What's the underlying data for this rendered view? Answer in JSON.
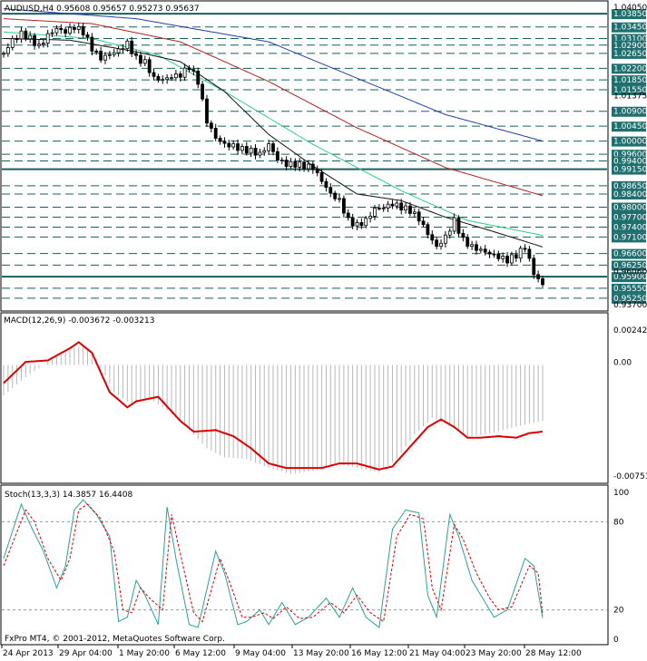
{
  "colors": {
    "background": "#ffffff",
    "grid": "#000000",
    "candle": "#000000",
    "level_line": "#1a5f5f",
    "ma_blue": "#1f3fa8",
    "ma_red": "#b22222",
    "ma_green": "#2ecc8a",
    "ma_black": "#111111",
    "macd_signal": "#dd0000",
    "macd_hist": "#b8b8b8",
    "stoch_main": "#2aa198",
    "stoch_signal": "#dd0000",
    "label_box": "#1f6f6f"
  },
  "header": {
    "symbol_info": "AUDUSD,H4  0.95608 0.95657 0.95273 0.95637"
  },
  "macd_panel": {
    "title": "MACD(12,26,9) -0.003672 -0.003213",
    "ticks": [
      "0.002422",
      "0.00",
      "-0.00751"
    ]
  },
  "stoch_panel": {
    "title": "Stoch(13,3,3) 14.3857 16.4408",
    "ticks": [
      "100",
      "80",
      "20",
      "0"
    ]
  },
  "copyright": "FxPro MT4, © 2001-2012, MetaQuotes Software Corp.",
  "price_axis": {
    "plain_ticks": [
      "1.04050",
      "1.01375",
      "0.96060",
      "0.93700"
    ],
    "level_labels": [
      "1.03850",
      "1.03450",
      "1.03100",
      "1.02900",
      "1.02650",
      "1.02200",
      "1.01850",
      "1.01550",
      "1.00900",
      "1.00450",
      "1.00000",
      "0.99600",
      "0.99400",
      "0.99150",
      "0.98650",
      "0.98400",
      "0.98000",
      "0.97700",
      "0.97400",
      "0.97100",
      "0.96600",
      "0.96250",
      "0.95900",
      "0.95550",
      "0.95250"
    ],
    "dark_levels": [
      "1.03850",
      "0.99150",
      "0.95900"
    ]
  },
  "time_axis": {
    "labels": [
      "24 Apr 2013",
      "29 Apr 04:00",
      "1 May 20:00",
      "6 May 12:00",
      "9 May 04:00",
      "13 May 20:00",
      "16 May 12:00",
      "21 May 04:00",
      "23 May 20:00",
      "28 May 12:00"
    ]
  },
  "chart_data": {
    "type": "line",
    "title": "AUDUSD,H4",
    "price_range": [
      0.95,
      1.041
    ],
    "close_anchors": [
      [
        0,
        1.0265
      ],
      [
        4,
        1.0305
      ],
      [
        8,
        1.0325
      ],
      [
        12,
        1.031
      ],
      [
        16,
        1.0285
      ],
      [
        20,
        1.032
      ],
      [
        24,
        1.034
      ],
      [
        28,
        1.033
      ],
      [
        32,
        1.0345
      ],
      [
        36,
        1.033
      ],
      [
        40,
        1.028
      ],
      [
        44,
        1.025
      ],
      [
        48,
        1.0262
      ],
      [
        52,
        1.0275
      ],
      [
        56,
        1.0295
      ],
      [
        60,
        1.025
      ],
      [
        64,
        1.0238
      ],
      [
        68,
        1.019
      ],
      [
        72,
        1.0185
      ],
      [
        76,
        1.0195
      ],
      [
        80,
        1.02
      ],
      [
        84,
        1.0225
      ],
      [
        88,
        1.018
      ],
      [
        92,
        1.006
      ],
      [
        96,
        1.001
      ],
      [
        100,
        0.999
      ],
      [
        104,
        0.9985
      ],
      [
        108,
        0.9975
      ],
      [
        112,
        0.997
      ],
      [
        116,
        0.996
      ],
      [
        120,
        0.999
      ],
      [
        124,
        0.9945
      ],
      [
        128,
        0.993
      ],
      [
        132,
        0.993
      ],
      [
        136,
        0.9925
      ],
      [
        140,
        0.992
      ],
      [
        144,
        0.988
      ],
      [
        148,
        0.984
      ],
      [
        152,
        0.982
      ],
      [
        156,
        0.976
      ],
      [
        160,
        0.9745
      ],
      [
        164,
        0.976
      ],
      [
        168,
        0.9795
      ],
      [
        172,
        0.98
      ],
      [
        176,
        0.981
      ],
      [
        180,
        0.98
      ],
      [
        184,
        0.979
      ],
      [
        188,
        0.9765
      ],
      [
        192,
        0.972
      ],
      [
        196,
        0.968
      ],
      [
        200,
        0.971
      ],
      [
        204,
        0.976
      ],
      [
        208,
        0.97
      ],
      [
        212,
        0.968
      ],
      [
        216,
        0.967
      ],
      [
        220,
        0.966
      ],
      [
        224,
        0.965
      ],
      [
        228,
        0.964
      ],
      [
        232,
        0.9655
      ],
      [
        236,
        0.968
      ],
      [
        240,
        0.96
      ],
      [
        244,
        0.9565
      ]
    ],
    "ma_blue": [
      [
        0,
        1.04
      ],
      [
        60,
        1.037
      ],
      [
        120,
        1.03
      ],
      [
        160,
        1.019
      ],
      [
        200,
        1.008
      ],
      [
        244,
        1.0
      ]
    ],
    "ma_red": [
      [
        0,
        1.037
      ],
      [
        40,
        1.0355
      ],
      [
        80,
        1.03
      ],
      [
        120,
        1.018
      ],
      [
        160,
        1.004
      ],
      [
        200,
        0.992
      ],
      [
        244,
        0.9835
      ]
    ],
    "ma_green": [
      [
        0,
        1.033
      ],
      [
        40,
        1.031
      ],
      [
        70,
        1.026
      ],
      [
        100,
        1.015
      ],
      [
        140,
        0.999
      ],
      [
        180,
        0.985
      ],
      [
        210,
        0.976
      ],
      [
        244,
        0.9715
      ]
    ],
    "ma_black": [
      [
        0,
        1.031
      ],
      [
        30,
        1.0305
      ],
      [
        60,
        1.027
      ],
      [
        80,
        1.024
      ],
      [
        100,
        1.015
      ],
      [
        120,
        1.002
      ],
      [
        140,
        0.9925
      ],
      [
        160,
        0.984
      ],
      [
        180,
        0.982
      ],
      [
        200,
        0.977
      ],
      [
        220,
        0.973
      ],
      [
        244,
        0.968
      ]
    ],
    "macd_range": [
      -0.00751,
      0.002422
    ],
    "macd_signal": [
      [
        0,
        -0.0012
      ],
      [
        10,
        0.0002
      ],
      [
        20,
        0.0003
      ],
      [
        30,
        0.0011
      ],
      [
        34,
        0.0015
      ],
      [
        40,
        0.0008
      ],
      [
        48,
        -0.0018
      ],
      [
        56,
        -0.0028
      ],
      [
        60,
        -0.0024
      ],
      [
        70,
        -0.0021
      ],
      [
        80,
        -0.0037
      ],
      [
        86,
        -0.0044
      ],
      [
        96,
        -0.0043
      ],
      [
        104,
        -0.0047
      ],
      [
        112,
        -0.0055
      ],
      [
        120,
        -0.0065
      ],
      [
        128,
        -0.0068
      ],
      [
        136,
        -0.0068
      ],
      [
        144,
        -0.0068
      ],
      [
        152,
        -0.0065
      ],
      [
        160,
        -0.0065
      ],
      [
        170,
        -0.0069
      ],
      [
        176,
        -0.0067
      ],
      [
        184,
        -0.0054
      ],
      [
        192,
        -0.0041
      ],
      [
        198,
        -0.0036
      ],
      [
        204,
        -0.0041
      ],
      [
        210,
        -0.0048
      ],
      [
        216,
        -0.0048
      ],
      [
        224,
        -0.0047
      ],
      [
        232,
        -0.0048
      ],
      [
        238,
        -0.0045
      ],
      [
        244,
        -0.0044
      ]
    ],
    "macd_hist": [
      [
        0,
        -0.002
      ],
      [
        10,
        -0.0008
      ],
      [
        20,
        0.0002
      ],
      [
        30,
        0.001
      ],
      [
        36,
        0.0013
      ],
      [
        42,
        0.0004
      ],
      [
        50,
        -0.0018
      ],
      [
        58,
        -0.0026
      ],
      [
        66,
        -0.0022
      ],
      [
        74,
        -0.003
      ],
      [
        82,
        -0.004
      ],
      [
        92,
        -0.0055
      ],
      [
        100,
        -0.0061
      ],
      [
        110,
        -0.0062
      ],
      [
        120,
        -0.0068
      ],
      [
        130,
        -0.0072
      ],
      [
        140,
        -0.007
      ],
      [
        150,
        -0.0065
      ],
      [
        160,
        -0.0068
      ],
      [
        170,
        -0.0071
      ],
      [
        178,
        -0.0062
      ],
      [
        186,
        -0.0046
      ],
      [
        194,
        -0.0035
      ],
      [
        202,
        -0.004
      ],
      [
        210,
        -0.0047
      ],
      [
        218,
        -0.0046
      ],
      [
        226,
        -0.0043
      ],
      [
        234,
        -0.004
      ],
      [
        244,
        -0.0037
      ]
    ],
    "stoch_main": [
      [
        0,
        55
      ],
      [
        8,
        92
      ],
      [
        12,
        78
      ],
      [
        18,
        60
      ],
      [
        24,
        35
      ],
      [
        28,
        50
      ],
      [
        32,
        88
      ],
      [
        36,
        95
      ],
      [
        42,
        85
      ],
      [
        48,
        70
      ],
      [
        52,
        12
      ],
      [
        56,
        15
      ],
      [
        60,
        40
      ],
      [
        64,
        30
      ],
      [
        70,
        10
      ],
      [
        74,
        90
      ],
      [
        78,
        55
      ],
      [
        84,
        10
      ],
      [
        88,
        8
      ],
      [
        96,
        60
      ],
      [
        100,
        45
      ],
      [
        106,
        10
      ],
      [
        110,
        12
      ],
      [
        116,
        20
      ],
      [
        120,
        10
      ],
      [
        126,
        25
      ],
      [
        132,
        10
      ],
      [
        138,
        15
      ],
      [
        146,
        28
      ],
      [
        152,
        15
      ],
      [
        158,
        35
      ],
      [
        164,
        15
      ],
      [
        170,
        8
      ],
      [
        176,
        75
      ],
      [
        182,
        88
      ],
      [
        188,
        86
      ],
      [
        192,
        30
      ],
      [
        196,
        15
      ],
      [
        202,
        85
      ],
      [
        206,
        70
      ],
      [
        212,
        40
      ],
      [
        218,
        25
      ],
      [
        222,
        15
      ],
      [
        228,
        20
      ],
      [
        236,
        55
      ],
      [
        240,
        50
      ],
      [
        244,
        14.3857
      ]
    ],
    "stoch_signal": [
      [
        0,
        50
      ],
      [
        10,
        88
      ],
      [
        14,
        80
      ],
      [
        20,
        55
      ],
      [
        26,
        40
      ],
      [
        30,
        55
      ],
      [
        34,
        88
      ],
      [
        38,
        92
      ],
      [
        44,
        82
      ],
      [
        50,
        60
      ],
      [
        54,
        20
      ],
      [
        58,
        18
      ],
      [
        62,
        35
      ],
      [
        66,
        28
      ],
      [
        72,
        20
      ],
      [
        76,
        85
      ],
      [
        80,
        58
      ],
      [
        86,
        18
      ],
      [
        90,
        12
      ],
      [
        98,
        55
      ],
      [
        102,
        40
      ],
      [
        108,
        15
      ],
      [
        112,
        15
      ],
      [
        118,
        18
      ],
      [
        122,
        14
      ],
      [
        128,
        22
      ],
      [
        134,
        14
      ],
      [
        140,
        15
      ],
      [
        148,
        25
      ],
      [
        154,
        18
      ],
      [
        160,
        30
      ],
      [
        166,
        18
      ],
      [
        172,
        12
      ],
      [
        178,
        70
      ],
      [
        184,
        85
      ],
      [
        190,
        82
      ],
      [
        194,
        35
      ],
      [
        198,
        20
      ],
      [
        204,
        78
      ],
      [
        208,
        68
      ],
      [
        214,
        45
      ],
      [
        220,
        28
      ],
      [
        224,
        20
      ],
      [
        230,
        22
      ],
      [
        238,
        50
      ],
      [
        242,
        45
      ],
      [
        244,
        16.4408
      ]
    ]
  }
}
